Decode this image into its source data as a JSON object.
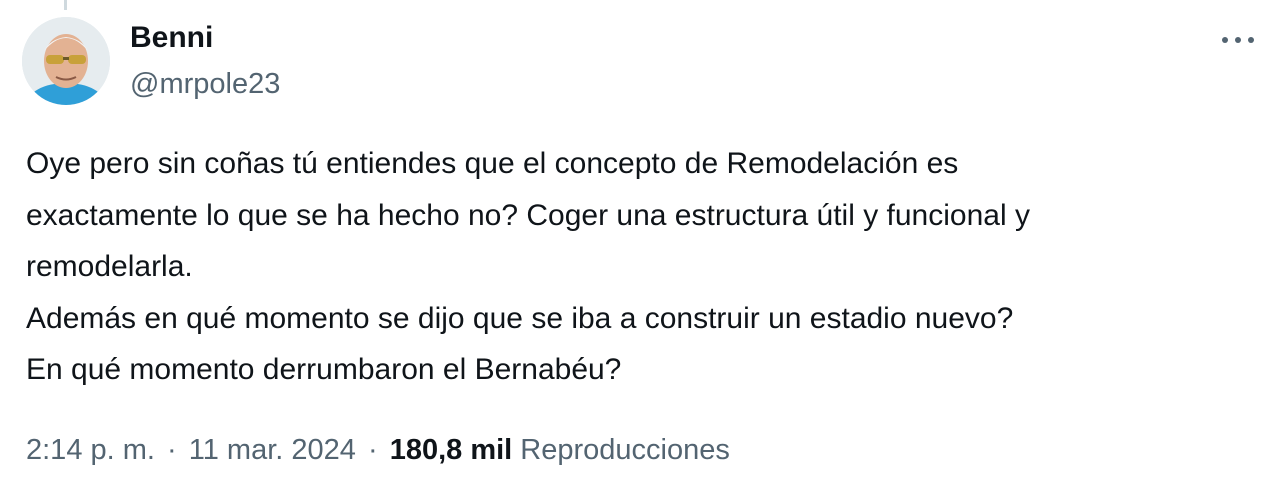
{
  "author": {
    "display_name": "Benni",
    "handle": "@mrpole23"
  },
  "tweet": {
    "lines": [
      "Oye pero sin coñas tú entiendes que el concepto de Remodelación es",
      "exactamente lo que se ha hecho no? Coger una estructura útil y funcional y",
      "remodelarla.",
      "Además en qué momento se dijo que se iba a construir un estadio nuevo?",
      "En qué momento derrumbaron el Bernabéu?"
    ]
  },
  "meta": {
    "time": "2:14 p. m.",
    "separator": "·",
    "date": "11 mar. 2024",
    "views_count": "180,8 mil",
    "views_label": "Reproducciones"
  },
  "icons": {
    "more": "more-horizontal-icon"
  },
  "colors": {
    "text_primary": "#0f1419",
    "text_secondary": "#536471",
    "thread_line": "#cfd9de"
  }
}
